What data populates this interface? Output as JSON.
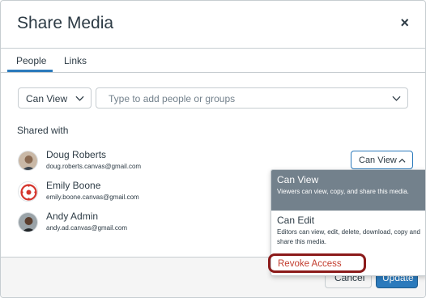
{
  "dialog": {
    "title": "Share Media",
    "close_label": "×"
  },
  "tabs": [
    {
      "label": "People",
      "selected": true
    },
    {
      "label": "Links",
      "selected": false
    }
  ],
  "permission_select": {
    "value": "Can View"
  },
  "people_input": {
    "placeholder": "Type to add people or groups"
  },
  "shared_with": {
    "heading": "Shared with",
    "people": [
      {
        "name": "Doug Roberts",
        "email": "doug.roberts.canvas@gmail.com",
        "role": "Can View"
      },
      {
        "name": "Emily Boone",
        "email": "emily.boone.canvas@gmail.com"
      },
      {
        "name": "Andy Admin",
        "email": "andy.ad.canvas@gmail.com"
      }
    ]
  },
  "role_menu": {
    "items": [
      {
        "label": "Can View",
        "description": "Viewers can view, copy, and share this media.",
        "selected": true
      },
      {
        "label": "Can Edit",
        "description": "Editors can view, edit, delete, download, copy and share this media.",
        "selected": false
      },
      {
        "label": "Revoke Access",
        "description": "",
        "selected": false
      }
    ]
  },
  "footer": {
    "cancel_label": "Cancel",
    "update_label": "Update"
  },
  "colors": {
    "accent": "#2b7abc",
    "highlight_border": "#8b1a1a",
    "danger": "#c23c2d",
    "menu_selected": "#73818c"
  },
  "icons": [
    "close-icon",
    "chevron-down-icon",
    "chevron-up-icon",
    "user-avatar",
    "canvas-logo-avatar"
  ]
}
